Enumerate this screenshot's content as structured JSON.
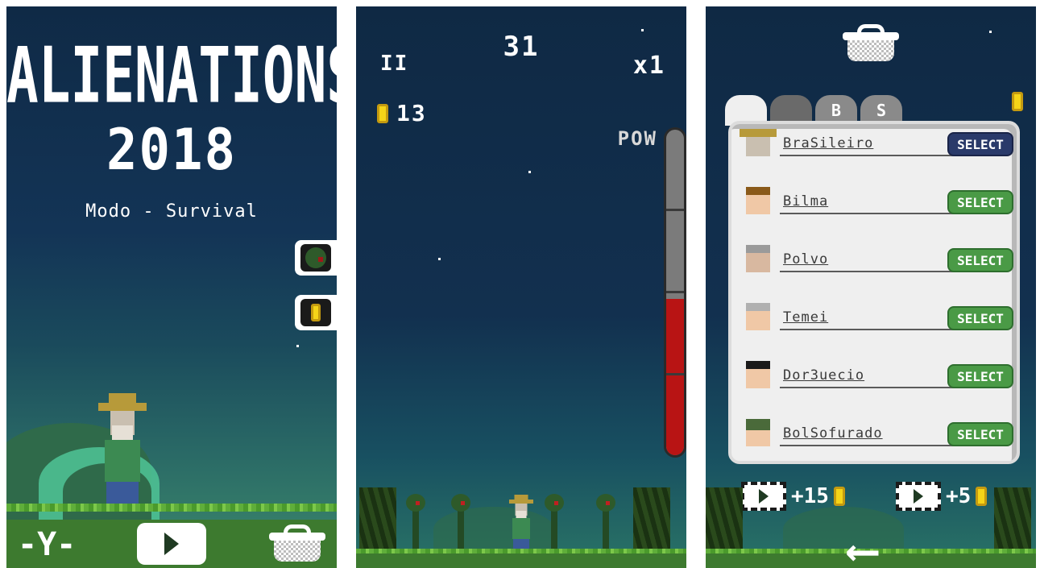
{
  "panel1": {
    "title_line1": "ALIENATIONS",
    "title_line2": "2018",
    "subtitle": "Modo - Survival",
    "tool_icon": "-Y-",
    "icons": [
      "alien-icon",
      "coin-icon",
      "tools-icon",
      "play-icon",
      "basket-icon"
    ]
  },
  "panel2": {
    "pause_label": "II",
    "score": "31",
    "multiplier": "x1",
    "coins": "13",
    "pow_label": "POW",
    "pow_level": 0.48
  },
  "panel3": {
    "tabs": [
      "",
      "",
      "B",
      "S"
    ],
    "characters": [
      {
        "name": "BraSileiro",
        "button": "SELECT",
        "selected": true
      },
      {
        "name": "Bilma",
        "button": "SELECT",
        "selected": false
      },
      {
        "name": "Polvo",
        "button": "SELECT",
        "selected": false
      },
      {
        "name": "Temei",
        "button": "SELECT",
        "selected": false
      },
      {
        "name": "Dor3uecio",
        "button": "SELECT",
        "selected": false
      },
      {
        "name": "BolSofurado",
        "button": "SELECT",
        "selected": false
      }
    ],
    "reward1": "+15",
    "reward2": "+5",
    "back_arrow": "⟵"
  },
  "colors": {
    "sky_top": "#0f2a46",
    "grass": "#5fae3a",
    "coin": "#f5d418",
    "select_green": "#4a9a46",
    "select_navy": "#2a3a6a",
    "pow_red": "#b81414"
  }
}
